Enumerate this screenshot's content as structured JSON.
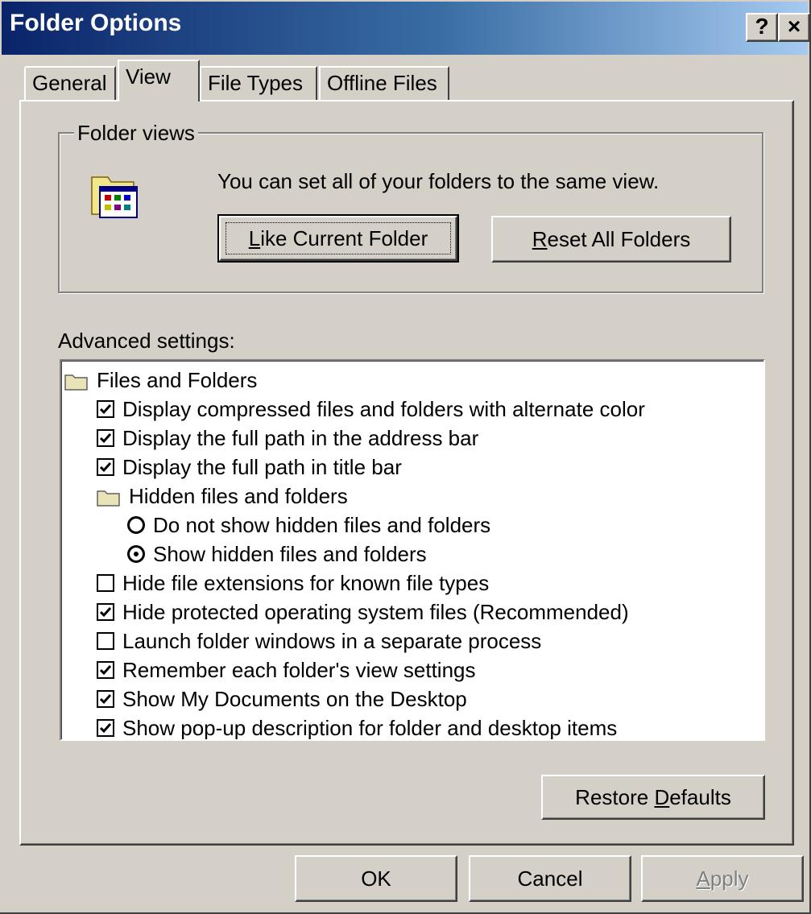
{
  "window": {
    "title": "Folder Options",
    "help_glyph": "?",
    "close_glyph": "×"
  },
  "tabs": [
    {
      "label": "General"
    },
    {
      "label": "View",
      "active": true
    },
    {
      "label": "File Types"
    },
    {
      "label": "Offline Files"
    }
  ],
  "folder_views": {
    "legend": "Folder views",
    "icon": "folder-view-icon",
    "description": "You can set all of your folders to the same view.",
    "like_current_pre": "",
    "like_current_accel": "L",
    "like_current_post": "ike Current Folder",
    "reset_all_pre": "",
    "reset_all_accel": "R",
    "reset_all_post": "eset All Folders"
  },
  "advanced": {
    "label": "Advanced settings:",
    "items": [
      {
        "type": "folder",
        "label": "Files and Folders",
        "level": 0
      },
      {
        "type": "checkbox",
        "label": "Display compressed files and folders with alternate color",
        "checked": true,
        "level": 1
      },
      {
        "type": "checkbox",
        "label": "Display the full path in the address bar",
        "checked": true,
        "level": 1
      },
      {
        "type": "checkbox",
        "label": "Display the full path in title bar",
        "checked": true,
        "level": 1
      },
      {
        "type": "folder",
        "label": "Hidden files and folders",
        "level": 1
      },
      {
        "type": "radio",
        "label": "Do not show hidden files and folders",
        "selected": false,
        "level": 2
      },
      {
        "type": "radio",
        "label": "Show hidden files and folders",
        "selected": true,
        "level": 2
      },
      {
        "type": "checkbox",
        "label": "Hide file extensions for known file types",
        "checked": false,
        "level": 1
      },
      {
        "type": "checkbox",
        "label": "Hide protected operating system files (Recommended)",
        "checked": true,
        "level": 1
      },
      {
        "type": "checkbox",
        "label": "Launch folder windows in a separate process",
        "checked": false,
        "level": 1
      },
      {
        "type": "checkbox",
        "label": "Remember each folder's view settings",
        "checked": true,
        "level": 1
      },
      {
        "type": "checkbox",
        "label": "Show My Documents on the Desktop",
        "checked": true,
        "level": 1
      },
      {
        "type": "checkbox",
        "label": "Show pop-up description for folder and desktop items",
        "checked": true,
        "level": 1
      }
    ],
    "restore_pre": "Restore ",
    "restore_accel": "D",
    "restore_post": "efaults"
  },
  "footer": {
    "ok": "OK",
    "cancel": "Cancel",
    "apply_accel": "A",
    "apply_post": "pply",
    "apply_enabled": false
  },
  "colors": {
    "title_gradient_start": "#0a246a",
    "title_gradient_end": "#a6caf0",
    "face": "#d4d0c8",
    "disabled_text": "#808080"
  }
}
